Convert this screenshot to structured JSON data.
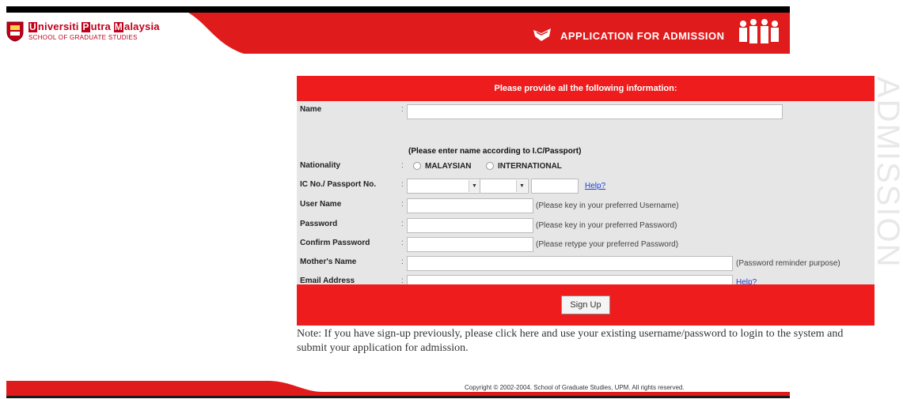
{
  "header": {
    "university": {
      "u": "U",
      "niversiti": "niversiti ",
      "p": "P",
      "utra": "utra ",
      "m": "M",
      "alaysia": "alaysia"
    },
    "school": "SCHOOL OF GRADUATE STUDIES",
    "title": "APPLICATION FOR ADMISSION",
    "brand_color": "#e01b1b"
  },
  "watermark": "ADMISSION",
  "form": {
    "heading": "Please provide all the following information:",
    "colon": ":",
    "fields": {
      "name": {
        "label": "Name",
        "value": "",
        "note": "(Please enter name according to I.C/Passport)"
      },
      "nationality": {
        "label": "Nationality",
        "options": [
          "MALAYSIAN",
          "INTERNATIONAL"
        ]
      },
      "ic": {
        "label": "IC No./ Passport No.",
        "help": "Help?"
      },
      "username": {
        "label": "User Name",
        "value": "",
        "hint": "(Please key in your preferred Username)"
      },
      "password": {
        "label": "Password",
        "value": "",
        "hint": "(Please key in your preferred Password)"
      },
      "confirm_password": {
        "label": "Confirm Password",
        "value": "",
        "hint": "(Please retype your preferred Password)"
      },
      "mother_name": {
        "label": "Mother's Name",
        "value": "",
        "hint": "(Password reminder purpose)"
      },
      "email": {
        "label": "Email Address",
        "value": "",
        "help": "Help?"
      }
    },
    "signup_label": "Sign Up"
  },
  "note": "Note: If you have sign-up previously, please click here and use your existing username/password to login to the system and submit your application for admission.",
  "footer": {
    "copyright": "Copyright © 2002-2004. School of Graduate Studies, UPM. All rights reserved."
  }
}
